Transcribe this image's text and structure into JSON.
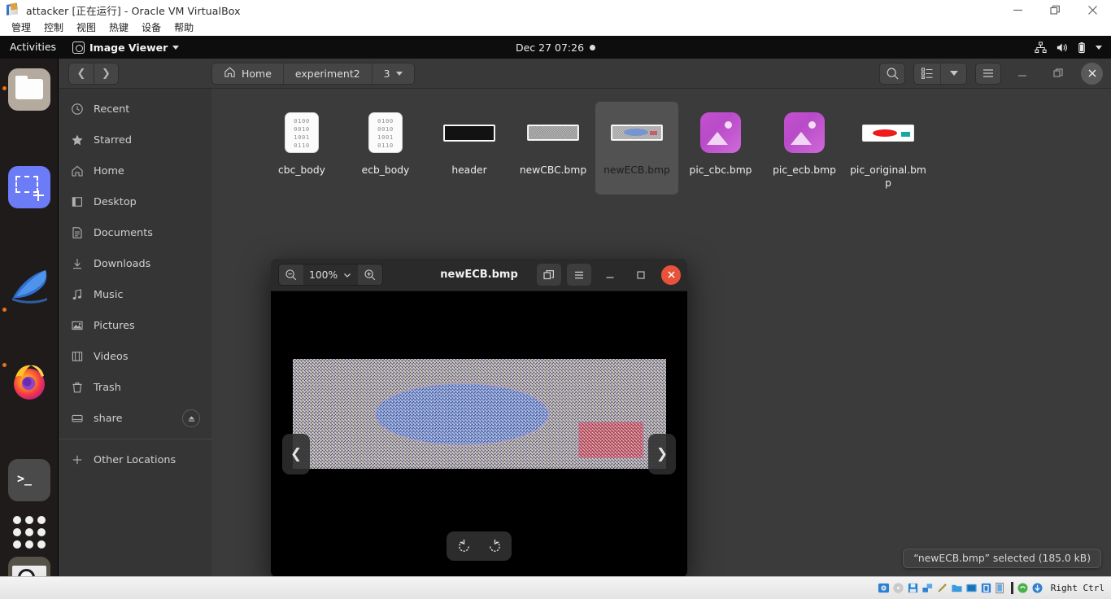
{
  "host_window": {
    "title": "attacker [正在运行] - Oracle VM VirtualBox",
    "icon": "virtualbox-icon",
    "menu": [
      "管理",
      "控制",
      "视图",
      "热键",
      "设备",
      "帮助"
    ],
    "buttons": {
      "minimize": "minimize-icon",
      "maximize": "restore-icon",
      "close": "close-icon"
    }
  },
  "gnome_panel": {
    "activities": "Activities",
    "app_name": "Image Viewer",
    "app_icon": "image-viewer-icon",
    "clock": "Dec 27  07:26",
    "recording_dot": "dot-indicator",
    "indicators": [
      "network-icon",
      "volume-icon",
      "battery-icon",
      "chevron-down-icon"
    ]
  },
  "dock": {
    "items": [
      {
        "name": "files",
        "icon": "files-icon",
        "running": true
      },
      {
        "name": "screenshot",
        "icon": "screenshot-icon",
        "running": false
      },
      {
        "name": "wireshark",
        "icon": "wireshark-icon",
        "running": false
      },
      {
        "name": "firefox",
        "icon": "firefox-icon",
        "running": false
      },
      {
        "name": "terminal",
        "icon": "terminal-icon",
        "running": true
      },
      {
        "name": "image-viewer",
        "icon": "magnifier-icon",
        "running": true
      }
    ],
    "show_apps": "show-applications-icon"
  },
  "files_window": {
    "nav": {
      "back": "chevron-left-icon",
      "forward": "chevron-right-icon"
    },
    "breadcrumbs": [
      {
        "label": "Home",
        "icon": "home-icon"
      },
      {
        "label": "experiment2",
        "icon": ""
      },
      {
        "label": "3",
        "icon": "chevron-down-icon"
      }
    ],
    "toolbar": {
      "search": "search-icon",
      "view_list": "list-view-icon",
      "view_dropdown": "chevron-down-icon",
      "menu": "hamburger-menu-icon",
      "minimize": "minimize-icon",
      "maximize": "maximize-icon",
      "close": "close-icon"
    },
    "sidebar": [
      {
        "label": "Recent",
        "icon": "clock-icon"
      },
      {
        "label": "Starred",
        "icon": "star-icon"
      },
      {
        "label": "Home",
        "icon": "home-icon"
      },
      {
        "label": "Desktop",
        "icon": "desktop-icon"
      },
      {
        "label": "Documents",
        "icon": "document-icon"
      },
      {
        "label": "Downloads",
        "icon": "download-icon"
      },
      {
        "label": "Music",
        "icon": "music-note-icon"
      },
      {
        "label": "Pictures",
        "icon": "picture-icon"
      },
      {
        "label": "Videos",
        "icon": "video-icon"
      },
      {
        "label": "Trash",
        "icon": "trash-icon"
      },
      {
        "label": "share",
        "icon": "drive-icon",
        "eject": "eject-icon"
      },
      {
        "label": "Other Locations",
        "icon": "plus-icon"
      }
    ],
    "files": [
      {
        "label": "cbc_body",
        "type": "binary",
        "selected": false,
        "binary_rows": [
          "0100",
          "0010",
          "1001",
          "0110"
        ]
      },
      {
        "label": "ecb_body",
        "type": "binary",
        "selected": false,
        "binary_rows": [
          "0100",
          "0010",
          "1001",
          "0110"
        ]
      },
      {
        "label": "header",
        "type": "bmp-black",
        "selected": false
      },
      {
        "label": "newCBC.bmp",
        "type": "bmp-noise",
        "selected": false
      },
      {
        "label": "newECB.bmp",
        "type": "bmp-ecb",
        "selected": true
      },
      {
        "label": "pic_cbc.bmp",
        "type": "image-generic",
        "selected": false
      },
      {
        "label": "pic_ecb.bmp",
        "type": "image-generic",
        "selected": false
      },
      {
        "label": "pic_original.bmp",
        "type": "bmp-original",
        "selected": false
      }
    ],
    "status": "“newECB.bmp” selected  (185.0 kB)"
  },
  "image_viewer": {
    "title": "newECB.bmp",
    "zoom_level": "100%",
    "zoom_out": "zoom-out-icon",
    "zoom_in": "zoom-in-icon",
    "zoom_dropdown": "chevron-down-icon",
    "fullscreen": "fullscreen-icon",
    "menu": "hamburger-menu-icon",
    "minimize": "minimize-icon",
    "maximize": "maximize-icon",
    "close": "close-icon",
    "prev": "chevron-left-icon",
    "next": "chevron-right-icon",
    "rotate_left": "rotate-left-icon",
    "rotate_right": "rotate-right-icon"
  },
  "vbox_statusbar": {
    "right_ctrl": "Right Ctrl",
    "indicators": [
      "hard-disk-icon",
      "optical-disk-icon",
      "floppy-icon",
      "network-icon",
      "usb-icon",
      "shared-folder-icon",
      "display-icon",
      "recording-icon",
      "vrde-icon",
      "mouse-capture-icon",
      "host-key-icon"
    ]
  },
  "colors": {
    "accent_orange": "#e8711a",
    "close_red": "#e8523a",
    "panel_bg": "#0d0d0d",
    "window_bg": "#3b3b3b",
    "sidebar_bg": "#353535"
  }
}
